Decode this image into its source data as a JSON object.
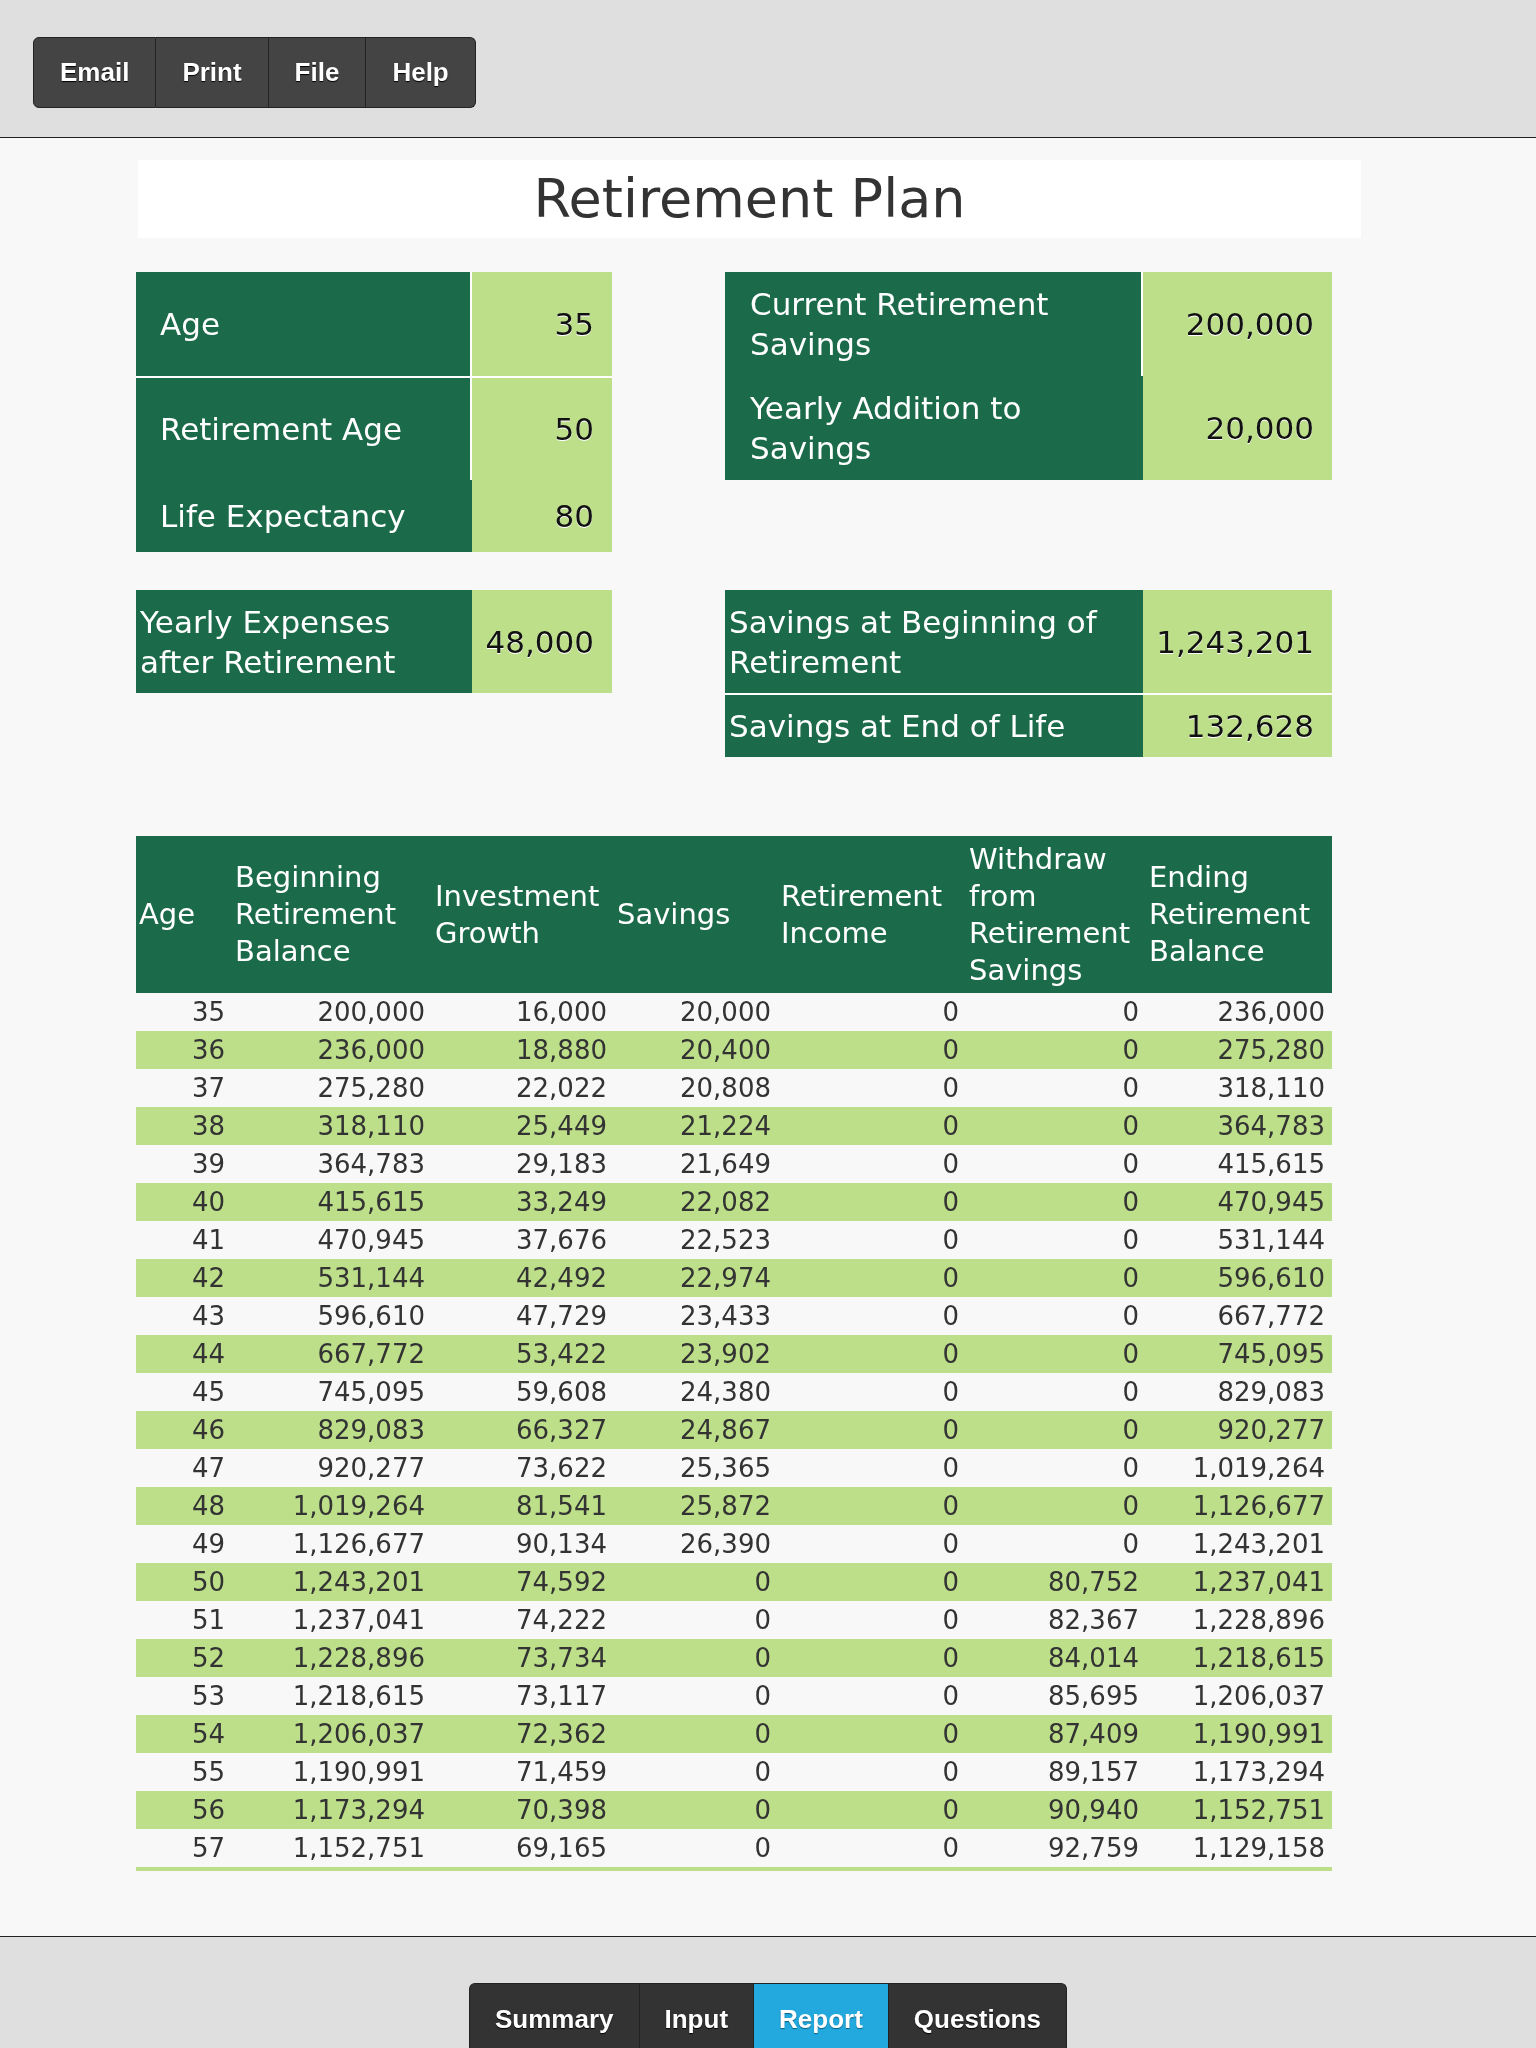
{
  "toolbar": {
    "buttons": [
      "Email",
      "Print",
      "File",
      "Help"
    ]
  },
  "title": "Retirement Plan",
  "age_inputs": {
    "rows": [
      {
        "label": "Age",
        "value": "35"
      },
      {
        "label": "Retirement Age",
        "value": "50"
      },
      {
        "label": "Life Expectancy",
        "value": "80"
      }
    ]
  },
  "savings_inputs": {
    "rows": [
      {
        "label": "Current Retirement Savings",
        "value": "200,000"
      },
      {
        "label": "Yearly Addition to Savings",
        "value": "20,000"
      }
    ]
  },
  "expense_inputs": {
    "rows": [
      {
        "label": "Yearly Expenses after Retirement",
        "value": "48,000"
      }
    ]
  },
  "savings_results": {
    "rows": [
      {
        "label": "Savings at Beginning of Retirement",
        "value": "1,243,201"
      },
      {
        "label": "Savings at End of Life",
        "value": "132,628"
      }
    ]
  },
  "table": {
    "columns": [
      "Age",
      "Beginning Retirement Balance",
      "Investment Growth",
      "Savings",
      "Retirement Income",
      "Withdraw from Retirement Savings",
      "Ending Retirement Balance"
    ],
    "rows": [
      [
        "35",
        "200,000",
        "16,000",
        "20,000",
        "0",
        "0",
        "236,000"
      ],
      [
        "36",
        "236,000",
        "18,880",
        "20,400",
        "0",
        "0",
        "275,280"
      ],
      [
        "37",
        "275,280",
        "22,022",
        "20,808",
        "0",
        "0",
        "318,110"
      ],
      [
        "38",
        "318,110",
        "25,449",
        "21,224",
        "0",
        "0",
        "364,783"
      ],
      [
        "39",
        "364,783",
        "29,183",
        "21,649",
        "0",
        "0",
        "415,615"
      ],
      [
        "40",
        "415,615",
        "33,249",
        "22,082",
        "0",
        "0",
        "470,945"
      ],
      [
        "41",
        "470,945",
        "37,676",
        "22,523",
        "0",
        "0",
        "531,144"
      ],
      [
        "42",
        "531,144",
        "42,492",
        "22,974",
        "0",
        "0",
        "596,610"
      ],
      [
        "43",
        "596,610",
        "47,729",
        "23,433",
        "0",
        "0",
        "667,772"
      ],
      [
        "44",
        "667,772",
        "53,422",
        "23,902",
        "0",
        "0",
        "745,095"
      ],
      [
        "45",
        "745,095",
        "59,608",
        "24,380",
        "0",
        "0",
        "829,083"
      ],
      [
        "46",
        "829,083",
        "66,327",
        "24,867",
        "0",
        "0",
        "920,277"
      ],
      [
        "47",
        "920,277",
        "73,622",
        "25,365",
        "0",
        "0",
        "1,019,264"
      ],
      [
        "48",
        "1,019,264",
        "81,541",
        "25,872",
        "0",
        "0",
        "1,126,677"
      ],
      [
        "49",
        "1,126,677",
        "90,134",
        "26,390",
        "0",
        "0",
        "1,243,201"
      ],
      [
        "50",
        "1,243,201",
        "74,592",
        "0",
        "0",
        "80,752",
        "1,237,041"
      ],
      [
        "51",
        "1,237,041",
        "74,222",
        "0",
        "0",
        "82,367",
        "1,228,896"
      ],
      [
        "52",
        "1,228,896",
        "73,734",
        "0",
        "0",
        "84,014",
        "1,218,615"
      ],
      [
        "53",
        "1,218,615",
        "73,117",
        "0",
        "0",
        "85,695",
        "1,206,037"
      ],
      [
        "54",
        "1,206,037",
        "72,362",
        "0",
        "0",
        "87,409",
        "1,190,991"
      ],
      [
        "55",
        "1,190,991",
        "71,459",
        "0",
        "0",
        "89,157",
        "1,173,294"
      ],
      [
        "56",
        "1,173,294",
        "70,398",
        "0",
        "0",
        "90,940",
        "1,152,751"
      ],
      [
        "57",
        "1,152,751",
        "69,165",
        "0",
        "0",
        "92,759",
        "1,129,158"
      ]
    ]
  },
  "tabs": [
    {
      "label": "Summary",
      "selected": false
    },
    {
      "label": "Input",
      "selected": false
    },
    {
      "label": "Report",
      "selected": true
    },
    {
      "label": "Questions",
      "selected": false
    }
  ]
}
